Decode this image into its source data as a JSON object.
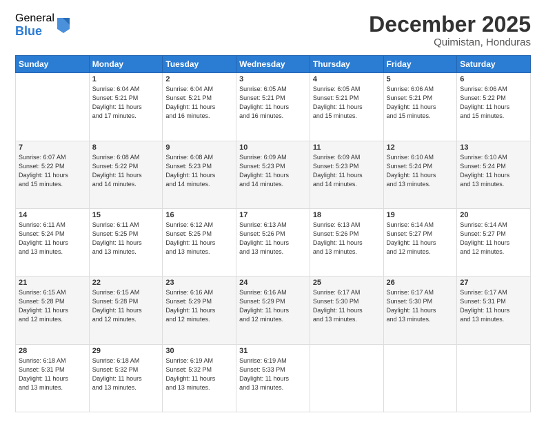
{
  "logo": {
    "general": "General",
    "blue": "Blue"
  },
  "header": {
    "month": "December 2025",
    "location": "Quimistan, Honduras"
  },
  "weekdays": [
    "Sunday",
    "Monday",
    "Tuesday",
    "Wednesday",
    "Thursday",
    "Friday",
    "Saturday"
  ],
  "weeks": [
    [
      {
        "day": "",
        "info": ""
      },
      {
        "day": "1",
        "info": "Sunrise: 6:04 AM\nSunset: 5:21 PM\nDaylight: 11 hours\nand 17 minutes."
      },
      {
        "day": "2",
        "info": "Sunrise: 6:04 AM\nSunset: 5:21 PM\nDaylight: 11 hours\nand 16 minutes."
      },
      {
        "day": "3",
        "info": "Sunrise: 6:05 AM\nSunset: 5:21 PM\nDaylight: 11 hours\nand 16 minutes."
      },
      {
        "day": "4",
        "info": "Sunrise: 6:05 AM\nSunset: 5:21 PM\nDaylight: 11 hours\nand 15 minutes."
      },
      {
        "day": "5",
        "info": "Sunrise: 6:06 AM\nSunset: 5:21 PM\nDaylight: 11 hours\nand 15 minutes."
      },
      {
        "day": "6",
        "info": "Sunrise: 6:06 AM\nSunset: 5:22 PM\nDaylight: 11 hours\nand 15 minutes."
      }
    ],
    [
      {
        "day": "7",
        "info": "Sunrise: 6:07 AM\nSunset: 5:22 PM\nDaylight: 11 hours\nand 15 minutes."
      },
      {
        "day": "8",
        "info": "Sunrise: 6:08 AM\nSunset: 5:22 PM\nDaylight: 11 hours\nand 14 minutes."
      },
      {
        "day": "9",
        "info": "Sunrise: 6:08 AM\nSunset: 5:23 PM\nDaylight: 11 hours\nand 14 minutes."
      },
      {
        "day": "10",
        "info": "Sunrise: 6:09 AM\nSunset: 5:23 PM\nDaylight: 11 hours\nand 14 minutes."
      },
      {
        "day": "11",
        "info": "Sunrise: 6:09 AM\nSunset: 5:23 PM\nDaylight: 11 hours\nand 14 minutes."
      },
      {
        "day": "12",
        "info": "Sunrise: 6:10 AM\nSunset: 5:24 PM\nDaylight: 11 hours\nand 13 minutes."
      },
      {
        "day": "13",
        "info": "Sunrise: 6:10 AM\nSunset: 5:24 PM\nDaylight: 11 hours\nand 13 minutes."
      }
    ],
    [
      {
        "day": "14",
        "info": "Sunrise: 6:11 AM\nSunset: 5:24 PM\nDaylight: 11 hours\nand 13 minutes."
      },
      {
        "day": "15",
        "info": "Sunrise: 6:11 AM\nSunset: 5:25 PM\nDaylight: 11 hours\nand 13 minutes."
      },
      {
        "day": "16",
        "info": "Sunrise: 6:12 AM\nSunset: 5:25 PM\nDaylight: 11 hours\nand 13 minutes."
      },
      {
        "day": "17",
        "info": "Sunrise: 6:13 AM\nSunset: 5:26 PM\nDaylight: 11 hours\nand 13 minutes."
      },
      {
        "day": "18",
        "info": "Sunrise: 6:13 AM\nSunset: 5:26 PM\nDaylight: 11 hours\nand 13 minutes."
      },
      {
        "day": "19",
        "info": "Sunrise: 6:14 AM\nSunset: 5:27 PM\nDaylight: 11 hours\nand 12 minutes."
      },
      {
        "day": "20",
        "info": "Sunrise: 6:14 AM\nSunset: 5:27 PM\nDaylight: 11 hours\nand 12 minutes."
      }
    ],
    [
      {
        "day": "21",
        "info": "Sunrise: 6:15 AM\nSunset: 5:28 PM\nDaylight: 11 hours\nand 12 minutes."
      },
      {
        "day": "22",
        "info": "Sunrise: 6:15 AM\nSunset: 5:28 PM\nDaylight: 11 hours\nand 12 minutes."
      },
      {
        "day": "23",
        "info": "Sunrise: 6:16 AM\nSunset: 5:29 PM\nDaylight: 11 hours\nand 12 minutes."
      },
      {
        "day": "24",
        "info": "Sunrise: 6:16 AM\nSunset: 5:29 PM\nDaylight: 11 hours\nand 12 minutes."
      },
      {
        "day": "25",
        "info": "Sunrise: 6:17 AM\nSunset: 5:30 PM\nDaylight: 11 hours\nand 13 minutes."
      },
      {
        "day": "26",
        "info": "Sunrise: 6:17 AM\nSunset: 5:30 PM\nDaylight: 11 hours\nand 13 minutes."
      },
      {
        "day": "27",
        "info": "Sunrise: 6:17 AM\nSunset: 5:31 PM\nDaylight: 11 hours\nand 13 minutes."
      }
    ],
    [
      {
        "day": "28",
        "info": "Sunrise: 6:18 AM\nSunset: 5:31 PM\nDaylight: 11 hours\nand 13 minutes."
      },
      {
        "day": "29",
        "info": "Sunrise: 6:18 AM\nSunset: 5:32 PM\nDaylight: 11 hours\nand 13 minutes."
      },
      {
        "day": "30",
        "info": "Sunrise: 6:19 AM\nSunset: 5:32 PM\nDaylight: 11 hours\nand 13 minutes."
      },
      {
        "day": "31",
        "info": "Sunrise: 6:19 AM\nSunset: 5:33 PM\nDaylight: 11 hours\nand 13 minutes."
      },
      {
        "day": "",
        "info": ""
      },
      {
        "day": "",
        "info": ""
      },
      {
        "day": "",
        "info": ""
      }
    ]
  ]
}
